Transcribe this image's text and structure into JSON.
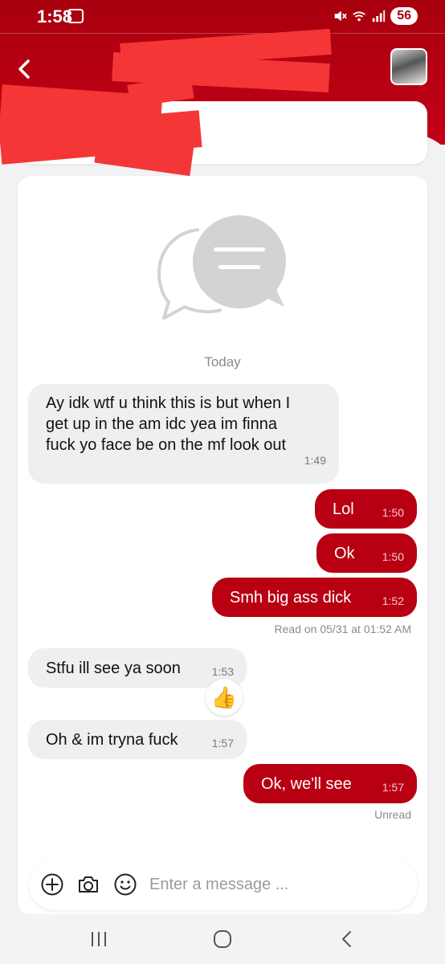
{
  "status_bar": {
    "time": "1:58",
    "battery": "56",
    "icons": [
      "screenshot-icon",
      "mute-icon",
      "wifi-icon",
      "signal-icon"
    ]
  },
  "header": {
    "back_icon": "chevron-left-icon",
    "contact_name": "",
    "redacted": true
  },
  "chat": {
    "empty_icon": "chat-bubbles-icon",
    "day_label": "Today",
    "messages": [
      {
        "direction": "incoming",
        "text": "Ay idk wtf u think this is but when I get up in the am idc yea im finna fuck yo face be on the mf look out",
        "time": "1:49"
      },
      {
        "direction": "outgoing",
        "text": "Lol",
        "time": "1:50"
      },
      {
        "direction": "outgoing",
        "text": "Ok",
        "time": "1:50"
      },
      {
        "direction": "outgoing",
        "text": "Smh big ass dick",
        "time": "1:52"
      },
      {
        "direction": "incoming",
        "text": "Stfu ill see ya soon",
        "time": "1:53",
        "reaction": "👍"
      },
      {
        "direction": "incoming",
        "text": "Oh & im tryna fuck",
        "time": "1:57"
      },
      {
        "direction": "outgoing",
        "text": "Ok, we'll see",
        "time": "1:57"
      }
    ],
    "read_receipt": "Read on 05/31 at 01:52 AM",
    "unread_label": "Unread"
  },
  "composer": {
    "placeholder": "Enter a message ...",
    "value": "",
    "icons": [
      "add-icon",
      "camera-icon",
      "emoji-icon"
    ]
  },
  "nav": {
    "icons": [
      "recent-apps-icon",
      "home-icon",
      "back-icon"
    ]
  },
  "colors": {
    "accent": "#b80012",
    "header": "#a8000d",
    "incoming_bubble": "#efeff1",
    "redaction": "#f53636"
  }
}
